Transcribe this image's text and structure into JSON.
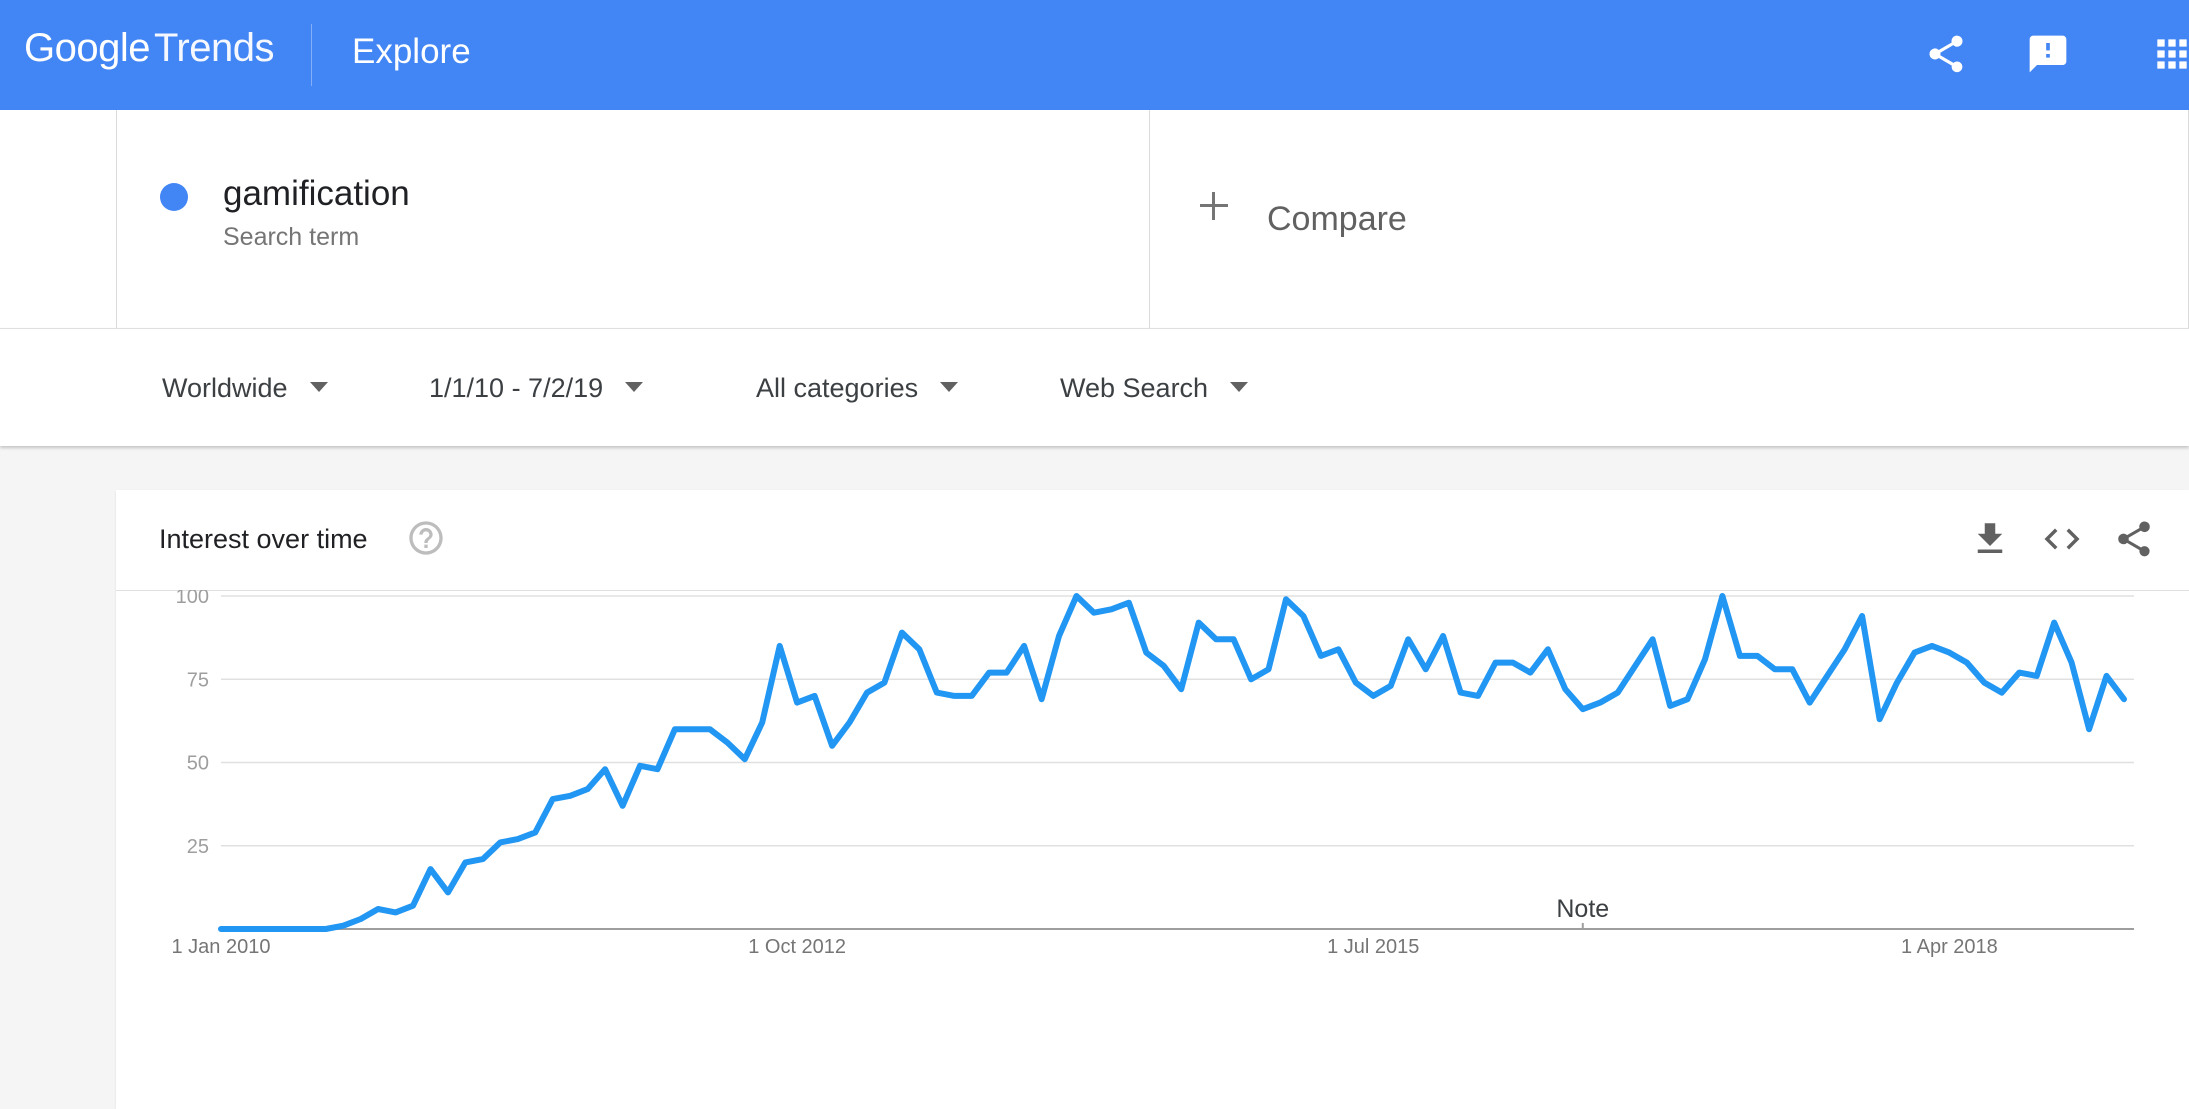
{
  "header": {
    "logo_google": "Google",
    "logo_trends": "Trends",
    "page_title": "Explore",
    "icons": [
      "share-icon",
      "feedback-icon",
      "apps-grid-icon"
    ],
    "bar_color": "#4285f4"
  },
  "search_term": {
    "name": "gamification",
    "subtitle": "Search term",
    "color": "#4285f4"
  },
  "compare": {
    "label": "Compare"
  },
  "filters": {
    "region": "Worldwide",
    "date_range": "1/1/10 - 7/2/19",
    "category": "All categories",
    "search_type": "Web Search"
  },
  "interest_card": {
    "title": "Interest over time",
    "icons": [
      "help-icon",
      "download-icon",
      "embed-icon",
      "share-icon"
    ],
    "note_label": "Note"
  },
  "chart_data": {
    "type": "line",
    "title": "",
    "xlabel": "",
    "ylabel": "",
    "ylim": [
      0,
      100
    ],
    "yticks": [
      25,
      50,
      75,
      100
    ],
    "x_tick_labels": [
      "1 Jan 2010",
      "1 Oct 2012",
      "1 Jul 2015",
      "1 Apr 2018"
    ],
    "x_range": [
      "2010-01",
      "2019-07"
    ],
    "grid": true,
    "line_color": "#2196f3",
    "series": [
      {
        "name": "gamification",
        "values": [
          0,
          0,
          0,
          0,
          0,
          0,
          0,
          1,
          3,
          6,
          5,
          7,
          18,
          11,
          20,
          21,
          26,
          27,
          29,
          39,
          40,
          42,
          48,
          37,
          49,
          48,
          60,
          60,
          60,
          56,
          51,
          62,
          85,
          68,
          70,
          55,
          62,
          71,
          74,
          89,
          84,
          71,
          70,
          70,
          77,
          77,
          85,
          69,
          88,
          100,
          95,
          96,
          98,
          83,
          79,
          72,
          92,
          87,
          87,
          75,
          78,
          99,
          94,
          82,
          84,
          74,
          70,
          73,
          87,
          78,
          88,
          71,
          70,
          80,
          80,
          77,
          84,
          72,
          66,
          68,
          71,
          79,
          87,
          67,
          69,
          81,
          100,
          82,
          82,
          78,
          78,
          68,
          76,
          84,
          94,
          63,
          74,
          83,
          85,
          83,
          80,
          74,
          71,
          77,
          76,
          92,
          80,
          60,
          76,
          69
        ]
      }
    ]
  }
}
